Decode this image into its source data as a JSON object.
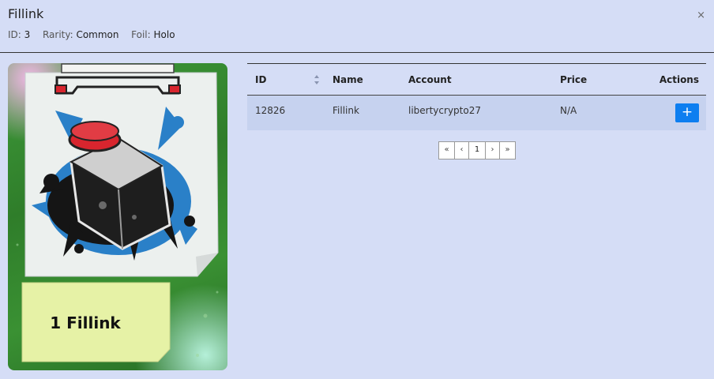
{
  "modal": {
    "title": "Fillink",
    "close_glyph": "×",
    "meta": {
      "id_label": "ID:",
      "id_value": "3",
      "rarity_label": "Rarity:",
      "rarity_value": "Common",
      "foil_label": "Foil:",
      "foil_value": "Holo"
    }
  },
  "card": {
    "caption": "1 Fillink",
    "foil": "holo",
    "colors": {
      "frame": "#2f7d2a",
      "ink": "#1b1b1b",
      "splash": "#2a80c8",
      "cap": "#d8252e"
    }
  },
  "table": {
    "columns": [
      "ID",
      "Name",
      "Account",
      "Price",
      "Actions"
    ],
    "rows": [
      {
        "id": "12826",
        "name": "Fillink",
        "account": "libertycrypto27",
        "price": "N/A",
        "action": "+"
      }
    ],
    "colors": {
      "row_bg": "#c6d2ef",
      "action_btn": "#0d7ef0"
    }
  },
  "pagination": {
    "first": "«",
    "prev": "‹",
    "current": "1",
    "next": "›",
    "last": "»"
  },
  "icons": {
    "close": "close-icon",
    "sort": "sort-icon",
    "add": "plus-icon"
  }
}
